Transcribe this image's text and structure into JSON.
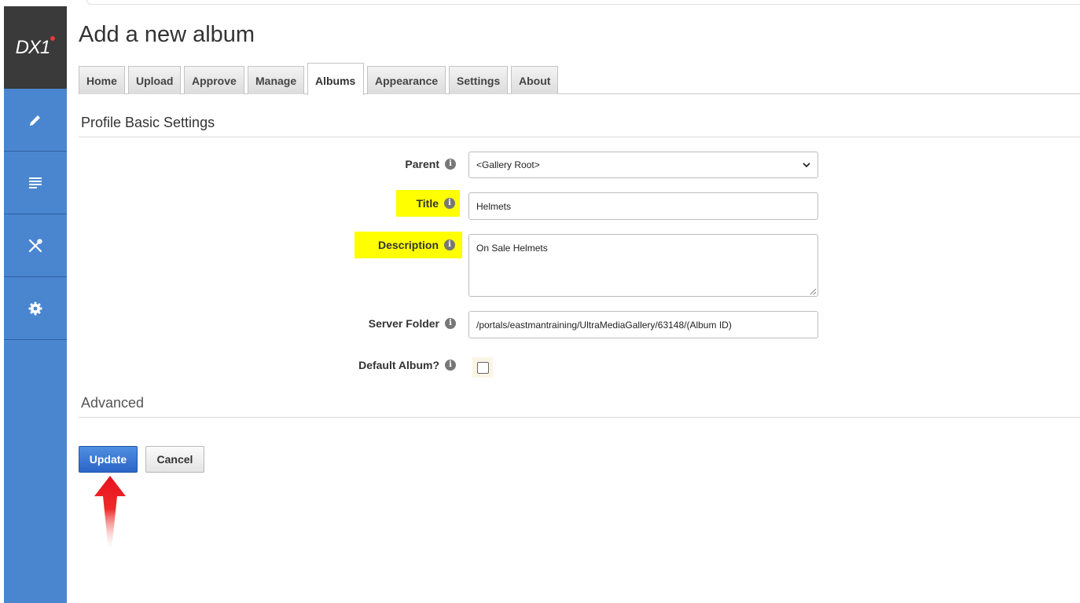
{
  "logo": {
    "text": "DX1"
  },
  "sidebar": {
    "items": [
      {
        "icon": "pencil-icon"
      },
      {
        "icon": "document-icon"
      },
      {
        "icon": "tools-icon"
      },
      {
        "icon": "gear-icon"
      }
    ]
  },
  "page": {
    "title": "Add a new album"
  },
  "tabs": [
    {
      "label": "Home"
    },
    {
      "label": "Upload"
    },
    {
      "label": "Approve"
    },
    {
      "label": "Manage"
    },
    {
      "label": "Albums",
      "active": true
    },
    {
      "label": "Appearance"
    },
    {
      "label": "Settings"
    },
    {
      "label": "About"
    }
  ],
  "sections": {
    "basic": "Profile Basic Settings",
    "advanced": "Advanced"
  },
  "form": {
    "parent": {
      "label": "Parent",
      "value": "<Gallery Root>"
    },
    "title": {
      "label": "Title",
      "value": "Helmets"
    },
    "description": {
      "label": "Description",
      "value": "On Sale Helmets"
    },
    "server_folder": {
      "label": "Server Folder",
      "value": "/portals/eastmantraining/UltraMediaGallery/63148/(Album ID)"
    },
    "default_album": {
      "label": "Default Album?",
      "checked": false
    }
  },
  "buttons": {
    "update": "Update",
    "cancel": "Cancel"
  },
  "colors": {
    "sidebar": "#4a86d0",
    "highlight": "#ffff00",
    "primary_button": "#2b65c7",
    "annotation_arrow": "#e8121b"
  }
}
